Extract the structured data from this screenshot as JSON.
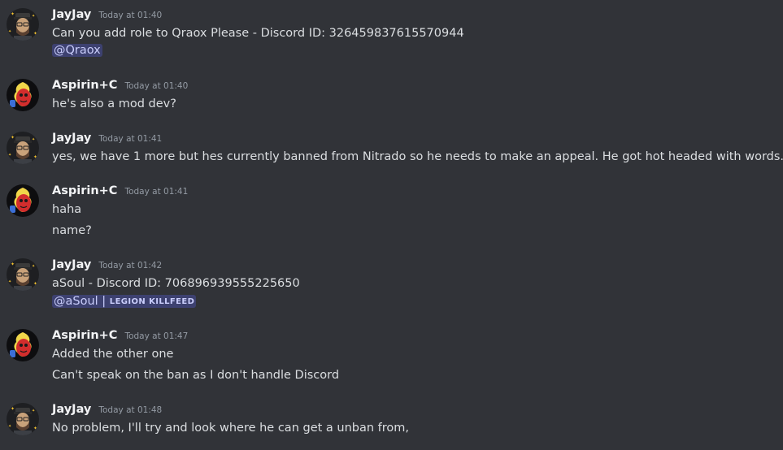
{
  "colors": {
    "background": "#313338",
    "username": "#f2f3f5",
    "timestamp": "#949ba4",
    "text": "#dbdee1",
    "mention_bg": "#45497a",
    "mention_text": "#c9cdfb"
  },
  "messages": [
    {
      "author": "JayJay",
      "avatar": "jayjay-avatar",
      "time": "Today at 01:40",
      "text": "Can you add role to Qraox Please - Discord ID: 326459837615570944",
      "mention": "@Qraox"
    },
    {
      "author": "Aspirin+C",
      "avatar": "aspirin-avatar",
      "time": "Today at 01:40",
      "text": "he's also a mod dev?"
    },
    {
      "author": "JayJay",
      "avatar": "jayjay-avatar",
      "time": "Today at 01:41",
      "text": "yes, we have 1 more but hes currently banned from Nitrado so he needs to make an appeal. He got hot headed with words..."
    },
    {
      "author": "Aspirin+C",
      "avatar": "aspirin-avatar",
      "time": "Today at 01:41",
      "text": "haha",
      "text2": "name?"
    },
    {
      "author": "JayJay",
      "avatar": "jayjay-avatar",
      "time": "Today at 01:42",
      "text": "aSoul - Discord ID: 706896939555225650",
      "mention": "@aSoul | ",
      "mention_tag": "LEGION KILLFEED"
    },
    {
      "author": "Aspirin+C",
      "avatar": "aspirin-avatar",
      "time": "Today at 01:47",
      "text": "Added the other one",
      "text2": "Can't speak on the ban as I don't handle Discord"
    },
    {
      "author": "JayJay",
      "avatar": "jayjay-avatar",
      "time": "Today at 01:48",
      "text": "No problem, I'll try and look where he can get a unban from,"
    }
  ]
}
